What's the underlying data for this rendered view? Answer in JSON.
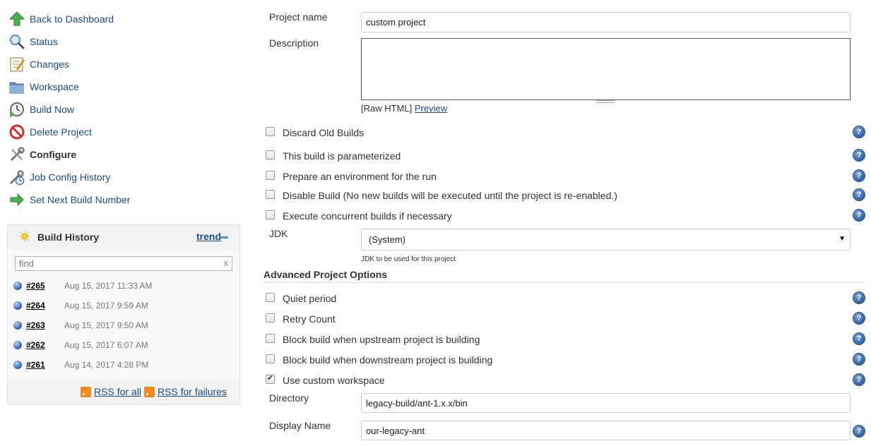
{
  "sidebar": {
    "tasks": [
      {
        "label": "Back to Dashboard",
        "icon": "up-arrow-icon"
      },
      {
        "label": "Status",
        "icon": "magnifier-icon"
      },
      {
        "label": "Changes",
        "icon": "notepad-icon"
      },
      {
        "label": "Workspace",
        "icon": "folder-icon"
      },
      {
        "label": "Build Now",
        "icon": "clock-icon"
      },
      {
        "label": "Delete Project",
        "icon": "no-entry-icon"
      },
      {
        "label": "Configure",
        "icon": "wrench-icon",
        "active": true
      },
      {
        "label": "Job Config History",
        "icon": "config-history-icon"
      },
      {
        "label": "Set Next Build Number",
        "icon": "next-arrow-icon"
      }
    ]
  },
  "build_history": {
    "title": "Build History",
    "trend_label": "trend",
    "find_placeholder": "find",
    "clear_label": "x",
    "builds": [
      {
        "number": "#265",
        "date": "Aug 15, 2017 11:33 AM"
      },
      {
        "number": "#264",
        "date": "Aug 15, 2017 9:59 AM"
      },
      {
        "number": "#263",
        "date": "Aug 15, 2017 9:50 AM"
      },
      {
        "number": "#262",
        "date": "Aug 15, 2017 6:07 AM"
      },
      {
        "number": "#261",
        "date": "Aug 14, 2017 4:28 PM"
      }
    ],
    "rss_all": "RSS for all",
    "rss_failures": "RSS for failures"
  },
  "form": {
    "project_name_label": "Project name",
    "project_name_value": "custom project",
    "description_label": "Description",
    "raw_html_label": "[Raw HTML]",
    "preview_label": "Preview",
    "options": [
      {
        "label": "Discard Old Builds",
        "checked": false
      },
      {
        "label": "This build is parameterized",
        "checked": false
      },
      {
        "label": "Prepare an environment for the run",
        "checked": false
      },
      {
        "label": "Disable Build (No new builds will be executed until the project is re-enabled.)",
        "checked": false
      },
      {
        "label": "Execute concurrent builds if necessary",
        "checked": false
      }
    ],
    "jdk_label": "JDK",
    "jdk_value": "(System)",
    "jdk_hint": "JDK to be used for this project",
    "advanced_title": "Advanced Project Options",
    "advanced_options": [
      {
        "label": "Quiet period",
        "checked": false
      },
      {
        "label": "Retry Count",
        "checked": false
      },
      {
        "label": "Block build when upstream project is building",
        "checked": false
      },
      {
        "label": "Block build when downstream project is building",
        "checked": false
      },
      {
        "label": "Use custom workspace",
        "checked": true
      }
    ],
    "directory_label": "Directory",
    "directory_value": "legacy-build/ant-1.x.x/bin",
    "display_name_label": "Display Name",
    "display_name_value": "our-legacy-ant",
    "help_glyph": "?"
  },
  "colors": {
    "link": "#204a87",
    "accent_blue": "#3d6fb8",
    "rss": "#f28a22"
  }
}
